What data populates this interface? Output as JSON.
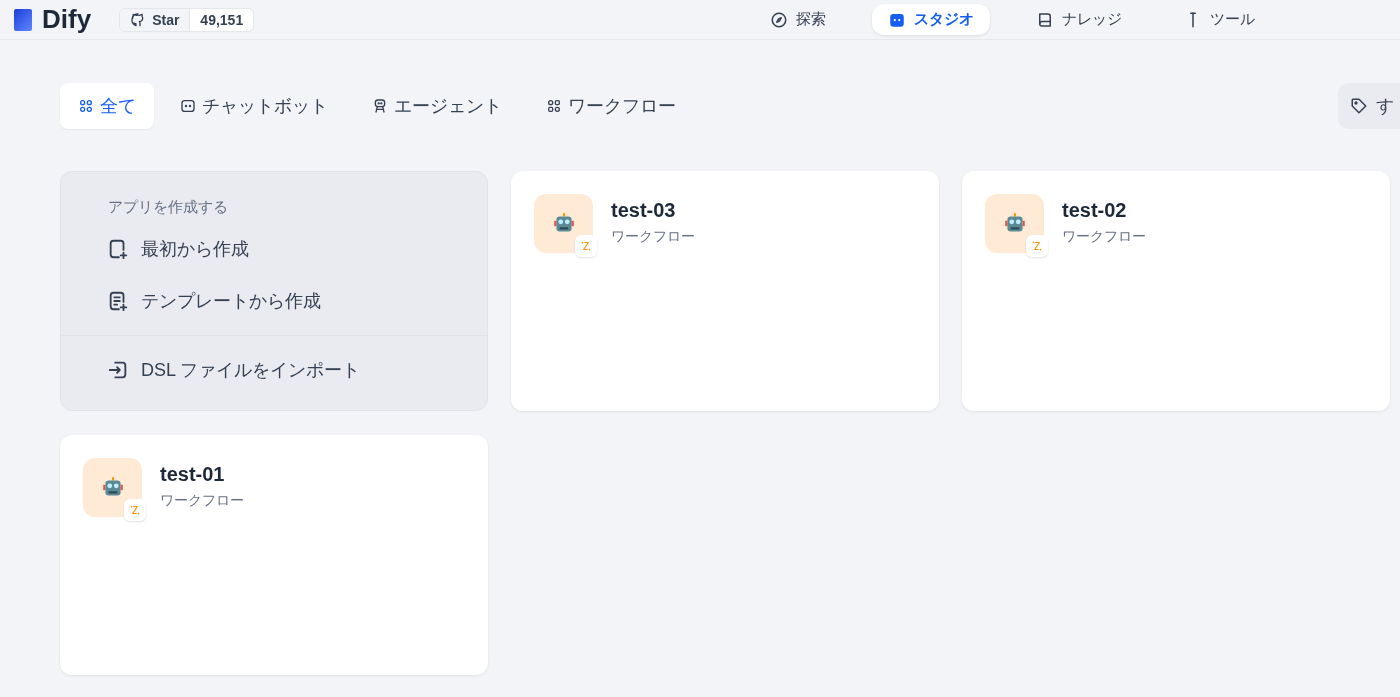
{
  "header": {
    "logo": "Dify",
    "github": {
      "label": "Star",
      "count": "49,151"
    },
    "nav": [
      {
        "label": "探索",
        "kind": "explore",
        "selected": false
      },
      {
        "label": "スタジオ",
        "kind": "studio",
        "selected": true
      },
      {
        "label": "ナレッジ",
        "kind": "knowledge",
        "selected": false
      },
      {
        "label": "ツール",
        "kind": "tools",
        "selected": false
      }
    ]
  },
  "filter_tabs": [
    {
      "label": "全て",
      "kind": "all",
      "selected": true
    },
    {
      "label": "チャットボット",
      "kind": "chat",
      "selected": false
    },
    {
      "label": "エージェント",
      "kind": "agent",
      "selected": false
    },
    {
      "label": "ワークフロー",
      "kind": "workflow",
      "selected": false
    }
  ],
  "tag_filter": {
    "label": "す"
  },
  "create_card": {
    "title": "アプリを作成する",
    "actions": [
      {
        "label": "最初から作成",
        "kind": "blank"
      },
      {
        "label": "テンプレートから作成",
        "kind": "template"
      }
    ],
    "import": {
      "label": "DSL ファイルをインポート"
    }
  },
  "apps": [
    {
      "name": "test-03",
      "type": "ワークフロー"
    },
    {
      "name": "test-02",
      "type": "ワークフロー"
    },
    {
      "name": "test-01",
      "type": "ワークフロー"
    }
  ]
}
